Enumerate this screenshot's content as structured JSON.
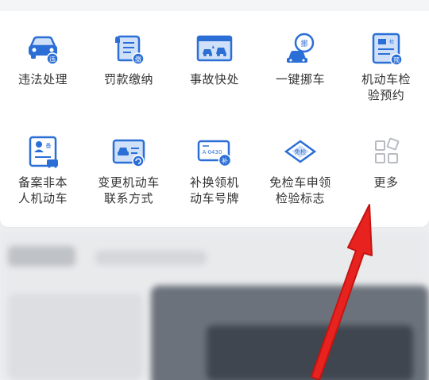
{
  "services": [
    {
      "label": "违法处理",
      "icon": "car-violation-icon",
      "badge": "违"
    },
    {
      "label": "罚款缴纳",
      "icon": "fine-receipt-icon",
      "badge": "缴"
    },
    {
      "label": "事故快处",
      "icon": "accident-cars-icon",
      "badge": ""
    },
    {
      "label": "一键挪车",
      "icon": "move-car-icon",
      "badge": "挪"
    },
    {
      "label": "机动车检\n验预约",
      "icon": "inspection-booking-icon",
      "badge": "预",
      "doc_tag": "检"
    },
    {
      "label": "备案非本\n人机动车",
      "icon": "registration-card-icon",
      "badge": "备"
    },
    {
      "label": "变更机动车\n联系方式",
      "icon": "change-contact-icon",
      "badge": ""
    },
    {
      "label": "补换领机\n动车号牌",
      "icon": "replace-plate-icon",
      "badge": "补",
      "plate_text": "A·0430"
    },
    {
      "label": "免检车申领\n检验标志",
      "icon": "exempt-inspection-icon",
      "badge": "免检"
    },
    {
      "label": "更多",
      "icon": "more-grid-icon",
      "badge": ""
    }
  ],
  "colors": {
    "accent": "#2b6fd6",
    "accent_light": "#cfe0f8",
    "label_text": "#333333",
    "arrow": "#e8231f",
    "more_icon": "#b8bcc2"
  }
}
